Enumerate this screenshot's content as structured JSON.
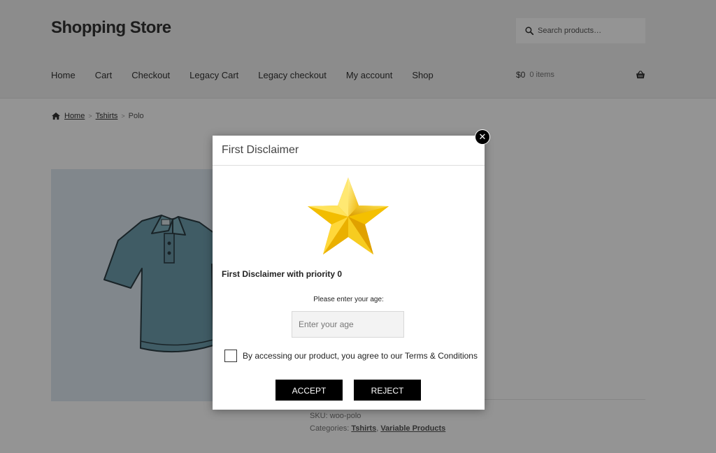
{
  "header": {
    "site_title": "Shopping Store",
    "search_placeholder": "Search products…",
    "search_icon": "search-icon",
    "nav": [
      {
        "label": "Home"
      },
      {
        "label": "Cart"
      },
      {
        "label": "Checkout"
      },
      {
        "label": "Legacy Cart"
      },
      {
        "label": "Legacy checkout"
      },
      {
        "label": "My account"
      },
      {
        "label": "Shop"
      }
    ],
    "cart": {
      "amount": "$0",
      "count": "0 items",
      "icon": "basket-icon"
    }
  },
  "breadcrumb": {
    "home": "Home",
    "category": "Tshirts",
    "current": "Polo",
    "separator": ">"
  },
  "product": {
    "image_icon": "polo-shirt-image",
    "sku_label": "SKU:",
    "sku": "woo-polo",
    "categories_label": "Categories:",
    "categories": [
      "Tshirts",
      "Variable Products"
    ],
    "categories_separator": ","
  },
  "modal": {
    "title": "First Disclaimer",
    "close_label": "✕",
    "image_icon": "star-icon",
    "heading": "First Disclaimer with priority 0",
    "age_label": "Please enter your age:",
    "age_placeholder": "Enter your age",
    "age_value": "",
    "terms_text": "By accessing our product, you agree to our Terms & Conditions",
    "terms_checked": false,
    "accept_label": "ACCEPT",
    "reject_label": "REJECT"
  },
  "colors": {
    "overlay": "#000000",
    "button_bg": "#000000",
    "button_text": "#ffffff",
    "star": "#f5c400",
    "shirt": "#6f9fae"
  }
}
